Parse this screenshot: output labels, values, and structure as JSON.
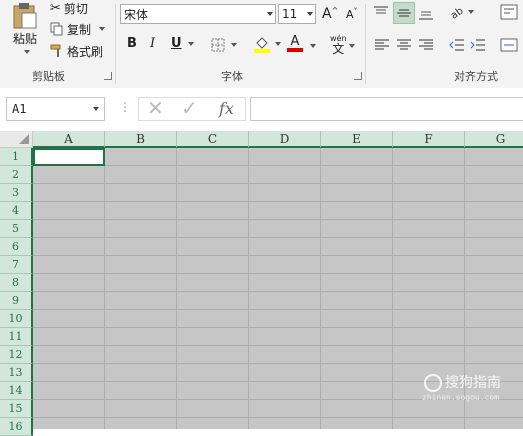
{
  "clipboard": {
    "paste_label": "粘贴",
    "cut_label": "剪切",
    "copy_label": "复制",
    "format_painter_label": "格式刷",
    "group_label": "剪贴板"
  },
  "font": {
    "font_name": "宋体",
    "font_size": "11",
    "increase_size_label": "A",
    "decrease_size_label": "A",
    "bold_label": "B",
    "italic_label": "I",
    "underline_label": "U",
    "phonetic_label": "wén",
    "font_color_label": "A",
    "group_label": "字体",
    "fill_color": "#ffff00",
    "font_color": "#e00000"
  },
  "alignment": {
    "group_label": "对齐方式"
  },
  "formula_bar": {
    "name_box": "A1",
    "fx_label": "fx",
    "value": ""
  },
  "sheet": {
    "columns": [
      "A",
      "B",
      "C",
      "D",
      "E",
      "F",
      "G"
    ],
    "rows": [
      "1",
      "2",
      "3",
      "4",
      "5",
      "6",
      "7",
      "8",
      "9",
      "10",
      "11",
      "12",
      "13",
      "14",
      "15",
      "16"
    ],
    "active_cell": "A1"
  },
  "watermark": {
    "text": "搜狗指南",
    "url": "zhinan.sogou.com"
  },
  "colors": {
    "accent": "#217346",
    "header_bg": "#d2e7da",
    "cell_bg": "#c6c6c6"
  }
}
